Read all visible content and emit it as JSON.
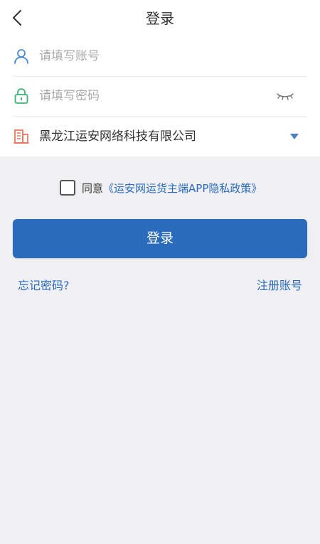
{
  "header": {
    "title": "登录"
  },
  "form": {
    "account_placeholder": "请填写账号",
    "password_placeholder": "请填写密码",
    "company": "黑龙江运安网络科技有限公司"
  },
  "agreement": {
    "prefix": "同意",
    "link": "《运安网运货主端APP隐私政策》",
    "checked": false
  },
  "actions": {
    "login_label": "登录",
    "forgot_label": "忘记密码?",
    "register_label": "注册账号"
  },
  "icons": {
    "back": "chevron-left-icon",
    "account": "user-icon",
    "password": "lock-icon",
    "eye": "eye-closed-icon",
    "company": "building-icon",
    "dropdown": "caret-down-icon"
  },
  "colors": {
    "accent": "#2b6bbb",
    "link": "#2a6bbf",
    "user_icon": "#4a8ad4",
    "lock_icon": "#3cb371",
    "building_icon": "#e8735a",
    "background": "#f0f0f2"
  }
}
